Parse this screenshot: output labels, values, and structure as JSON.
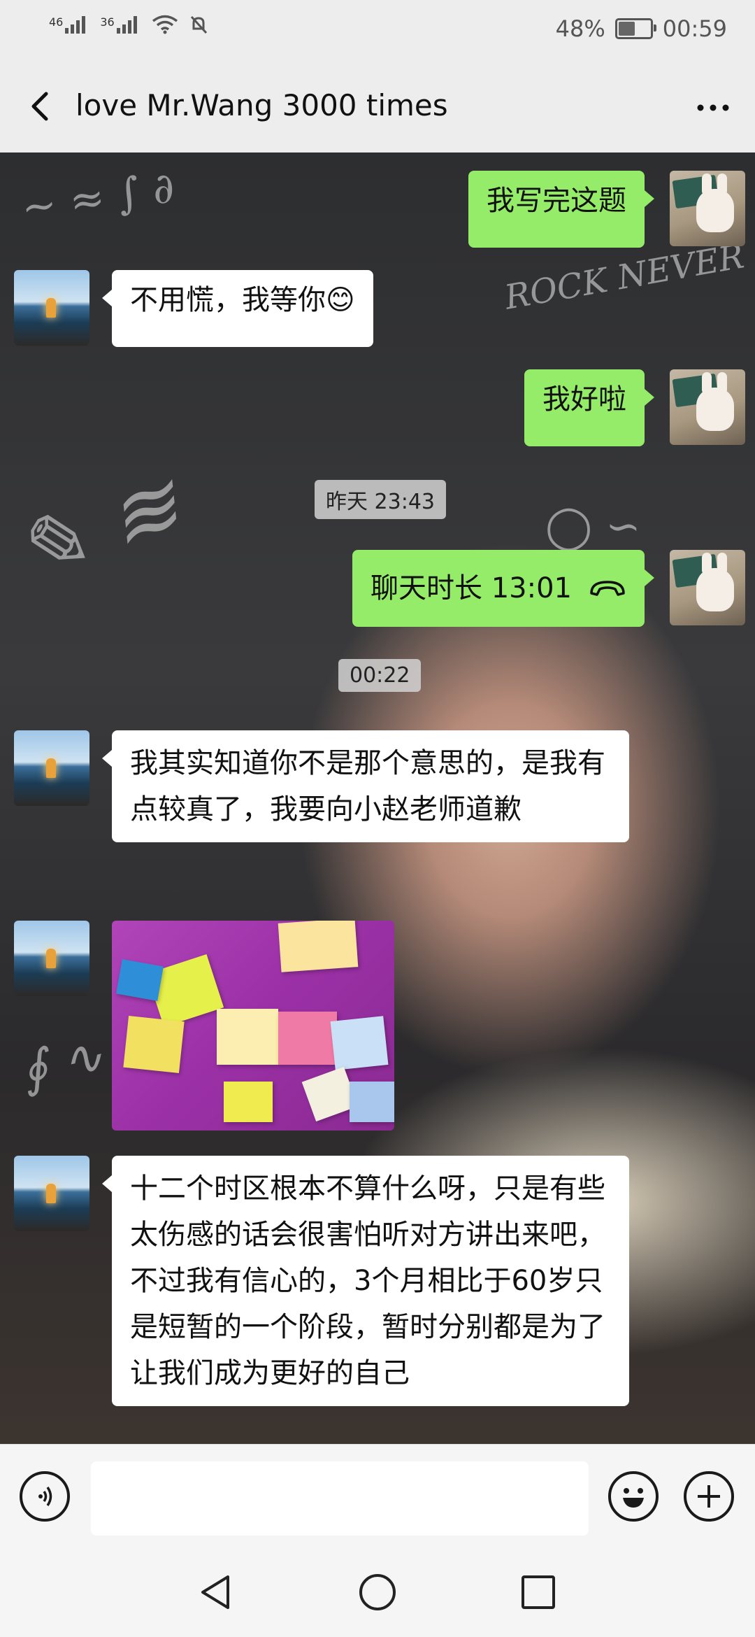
{
  "status_bar": {
    "signal1": "46",
    "signal2": "36",
    "battery_percent": "48%",
    "battery_level": 0.48,
    "time": "00:59"
  },
  "header": {
    "title": "love Mr.Wang 3000 times"
  },
  "messages": [
    {
      "side": "out",
      "text": "我写完这题"
    },
    {
      "side": "in",
      "text": "不用慌，我等你😊"
    },
    {
      "side": "out",
      "text": "我好啦"
    },
    {
      "time": "昨天 23:43"
    },
    {
      "side": "out",
      "text": "聊天时长 13:01"
    },
    {
      "time": "00:22"
    },
    {
      "side": "in",
      "text": "我其实知道你不是那个意思的，是我有点较真了，我要向小赵老师道歉"
    },
    {
      "side": "in",
      "type": "image"
    },
    {
      "side": "in",
      "text": "十二个时区根本不算什么呀，只是有些太伤感的话会很害怕听对方讲出来吧，不过我有信心的，3个月相比于60岁只是短暂的一个阶段，暂时分别都是为了让我们成为更好的自己"
    }
  ],
  "colors": {
    "outgoing_bubble": "#95ec69",
    "incoming_bubble": "#ffffff",
    "bar_background": "#ededed"
  }
}
